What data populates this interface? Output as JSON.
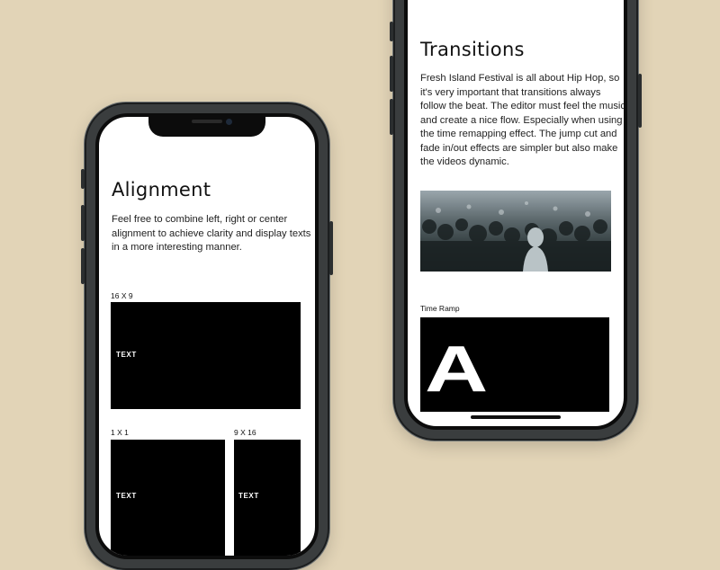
{
  "left_screen": {
    "heading": "Alignment",
    "body": "Feel free to combine left, right or center alignment to achieve clarity and display texts in a more interesting manner.",
    "formats": [
      {
        "label": "16 X 9",
        "box_text": "TEXT"
      },
      {
        "label": "1 X 1",
        "box_text": "TEXT"
      },
      {
        "label": "9 X 16",
        "box_text": "TEXT"
      }
    ]
  },
  "right_screen": {
    "heading": "Transitions",
    "body": "Fresh Island Festival is all about Hip Hop, so it's very important that transitions always follow the beat. The editor must feel the music and create a nice flow. Especially when using the time remapping effect. The jump cut and fade in/out effects are simpler but also make the videos dynamic.",
    "image": "crowd-photo",
    "time_ramp": {
      "label": "Time Ramp",
      "letter": "A"
    }
  },
  "colors": {
    "background": "#e2d4b7",
    "screen": "#ffffff",
    "box": "#000000",
    "phone_frame": "#3a3d3e"
  }
}
